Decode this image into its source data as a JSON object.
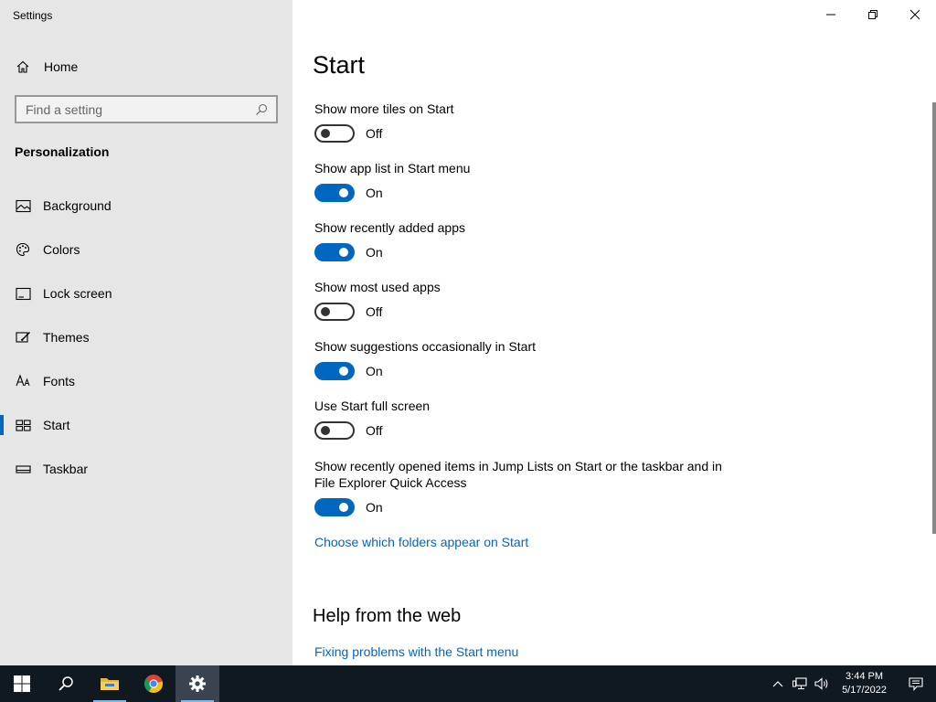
{
  "window": {
    "title": "Settings",
    "controls": [
      "minimize",
      "restore",
      "close"
    ]
  },
  "sidebar": {
    "home_label": "Home",
    "search_placeholder": "Find a setting",
    "section_title": "Personalization",
    "items": [
      {
        "label": "Background",
        "icon": "background-icon",
        "selected": false
      },
      {
        "label": "Colors",
        "icon": "palette-icon",
        "selected": false
      },
      {
        "label": "Lock screen",
        "icon": "lock-screen-icon",
        "selected": false
      },
      {
        "label": "Themes",
        "icon": "themes-icon",
        "selected": false
      },
      {
        "label": "Fonts",
        "icon": "fonts-icon",
        "selected": false
      },
      {
        "label": "Start",
        "icon": "start-icon",
        "selected": true
      },
      {
        "label": "Taskbar",
        "icon": "taskbar-icon",
        "selected": false
      }
    ]
  },
  "main": {
    "title": "Start",
    "settings": [
      {
        "label": "Show more tiles on Start",
        "state": "Off",
        "on": false
      },
      {
        "label": "Show app list in Start menu",
        "state": "On",
        "on": true
      },
      {
        "label": "Show recently added apps",
        "state": "On",
        "on": true
      },
      {
        "label": "Show most used apps",
        "state": "Off",
        "on": false
      },
      {
        "label": "Show suggestions occasionally in Start",
        "state": "On",
        "on": true
      },
      {
        "label": "Use Start full screen",
        "state": "Off",
        "on": false
      },
      {
        "label": "Show recently opened items in Jump Lists on Start or the taskbar and in File Explorer Quick Access",
        "state": "On",
        "on": true
      }
    ],
    "folders_link": "Choose which folders appear on Start",
    "help_title": "Help from the web",
    "help_link": "Fixing problems with the Start menu"
  },
  "taskbar": {
    "apps": [
      "windows-start-icon",
      "search-icon",
      "file-explorer-icon",
      "chrome-icon",
      "settings-gear-icon"
    ],
    "time": "3:44 PM",
    "date": "5/17/2022"
  },
  "colors": {
    "accent": "#0067c0",
    "sidebar_bg": "#e6e6e6",
    "taskbar_bg": "#101820"
  }
}
